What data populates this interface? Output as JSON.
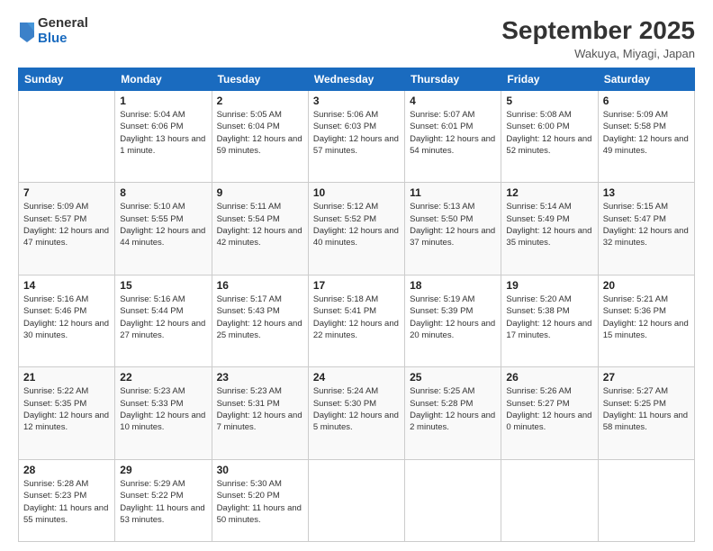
{
  "logo": {
    "general": "General",
    "blue": "Blue"
  },
  "title": "September 2025",
  "location": "Wakuya, Miyagi, Japan",
  "weekdays": [
    "Sunday",
    "Monday",
    "Tuesday",
    "Wednesday",
    "Thursday",
    "Friday",
    "Saturday"
  ],
  "weeks": [
    [
      {
        "day": "",
        "sunrise": "",
        "sunset": "",
        "daylight": ""
      },
      {
        "day": "1",
        "sunrise": "Sunrise: 5:04 AM",
        "sunset": "Sunset: 6:06 PM",
        "daylight": "Daylight: 13 hours and 1 minute."
      },
      {
        "day": "2",
        "sunrise": "Sunrise: 5:05 AM",
        "sunset": "Sunset: 6:04 PM",
        "daylight": "Daylight: 12 hours and 59 minutes."
      },
      {
        "day": "3",
        "sunrise": "Sunrise: 5:06 AM",
        "sunset": "Sunset: 6:03 PM",
        "daylight": "Daylight: 12 hours and 57 minutes."
      },
      {
        "day": "4",
        "sunrise": "Sunrise: 5:07 AM",
        "sunset": "Sunset: 6:01 PM",
        "daylight": "Daylight: 12 hours and 54 minutes."
      },
      {
        "day": "5",
        "sunrise": "Sunrise: 5:08 AM",
        "sunset": "Sunset: 6:00 PM",
        "daylight": "Daylight: 12 hours and 52 minutes."
      },
      {
        "day": "6",
        "sunrise": "Sunrise: 5:09 AM",
        "sunset": "Sunset: 5:58 PM",
        "daylight": "Daylight: 12 hours and 49 minutes."
      }
    ],
    [
      {
        "day": "7",
        "sunrise": "Sunrise: 5:09 AM",
        "sunset": "Sunset: 5:57 PM",
        "daylight": "Daylight: 12 hours and 47 minutes."
      },
      {
        "day": "8",
        "sunrise": "Sunrise: 5:10 AM",
        "sunset": "Sunset: 5:55 PM",
        "daylight": "Daylight: 12 hours and 44 minutes."
      },
      {
        "day": "9",
        "sunrise": "Sunrise: 5:11 AM",
        "sunset": "Sunset: 5:54 PM",
        "daylight": "Daylight: 12 hours and 42 minutes."
      },
      {
        "day": "10",
        "sunrise": "Sunrise: 5:12 AM",
        "sunset": "Sunset: 5:52 PM",
        "daylight": "Daylight: 12 hours and 40 minutes."
      },
      {
        "day": "11",
        "sunrise": "Sunrise: 5:13 AM",
        "sunset": "Sunset: 5:50 PM",
        "daylight": "Daylight: 12 hours and 37 minutes."
      },
      {
        "day": "12",
        "sunrise": "Sunrise: 5:14 AM",
        "sunset": "Sunset: 5:49 PM",
        "daylight": "Daylight: 12 hours and 35 minutes."
      },
      {
        "day": "13",
        "sunrise": "Sunrise: 5:15 AM",
        "sunset": "Sunset: 5:47 PM",
        "daylight": "Daylight: 12 hours and 32 minutes."
      }
    ],
    [
      {
        "day": "14",
        "sunrise": "Sunrise: 5:16 AM",
        "sunset": "Sunset: 5:46 PM",
        "daylight": "Daylight: 12 hours and 30 minutes."
      },
      {
        "day": "15",
        "sunrise": "Sunrise: 5:16 AM",
        "sunset": "Sunset: 5:44 PM",
        "daylight": "Daylight: 12 hours and 27 minutes."
      },
      {
        "day": "16",
        "sunrise": "Sunrise: 5:17 AM",
        "sunset": "Sunset: 5:43 PM",
        "daylight": "Daylight: 12 hours and 25 minutes."
      },
      {
        "day": "17",
        "sunrise": "Sunrise: 5:18 AM",
        "sunset": "Sunset: 5:41 PM",
        "daylight": "Daylight: 12 hours and 22 minutes."
      },
      {
        "day": "18",
        "sunrise": "Sunrise: 5:19 AM",
        "sunset": "Sunset: 5:39 PM",
        "daylight": "Daylight: 12 hours and 20 minutes."
      },
      {
        "day": "19",
        "sunrise": "Sunrise: 5:20 AM",
        "sunset": "Sunset: 5:38 PM",
        "daylight": "Daylight: 12 hours and 17 minutes."
      },
      {
        "day": "20",
        "sunrise": "Sunrise: 5:21 AM",
        "sunset": "Sunset: 5:36 PM",
        "daylight": "Daylight: 12 hours and 15 minutes."
      }
    ],
    [
      {
        "day": "21",
        "sunrise": "Sunrise: 5:22 AM",
        "sunset": "Sunset: 5:35 PM",
        "daylight": "Daylight: 12 hours and 12 minutes."
      },
      {
        "day": "22",
        "sunrise": "Sunrise: 5:23 AM",
        "sunset": "Sunset: 5:33 PM",
        "daylight": "Daylight: 12 hours and 10 minutes."
      },
      {
        "day": "23",
        "sunrise": "Sunrise: 5:23 AM",
        "sunset": "Sunset: 5:31 PM",
        "daylight": "Daylight: 12 hours and 7 minutes."
      },
      {
        "day": "24",
        "sunrise": "Sunrise: 5:24 AM",
        "sunset": "Sunset: 5:30 PM",
        "daylight": "Daylight: 12 hours and 5 minutes."
      },
      {
        "day": "25",
        "sunrise": "Sunrise: 5:25 AM",
        "sunset": "Sunset: 5:28 PM",
        "daylight": "Daylight: 12 hours and 2 minutes."
      },
      {
        "day": "26",
        "sunrise": "Sunrise: 5:26 AM",
        "sunset": "Sunset: 5:27 PM",
        "daylight": "Daylight: 12 hours and 0 minutes."
      },
      {
        "day": "27",
        "sunrise": "Sunrise: 5:27 AM",
        "sunset": "Sunset: 5:25 PM",
        "daylight": "Daylight: 11 hours and 58 minutes."
      }
    ],
    [
      {
        "day": "28",
        "sunrise": "Sunrise: 5:28 AM",
        "sunset": "Sunset: 5:23 PM",
        "daylight": "Daylight: 11 hours and 55 minutes."
      },
      {
        "day": "29",
        "sunrise": "Sunrise: 5:29 AM",
        "sunset": "Sunset: 5:22 PM",
        "daylight": "Daylight: 11 hours and 53 minutes."
      },
      {
        "day": "30",
        "sunrise": "Sunrise: 5:30 AM",
        "sunset": "Sunset: 5:20 PM",
        "daylight": "Daylight: 11 hours and 50 minutes."
      },
      {
        "day": "",
        "sunrise": "",
        "sunset": "",
        "daylight": ""
      },
      {
        "day": "",
        "sunrise": "",
        "sunset": "",
        "daylight": ""
      },
      {
        "day": "",
        "sunrise": "",
        "sunset": "",
        "daylight": ""
      },
      {
        "day": "",
        "sunrise": "",
        "sunset": "",
        "daylight": ""
      }
    ]
  ]
}
